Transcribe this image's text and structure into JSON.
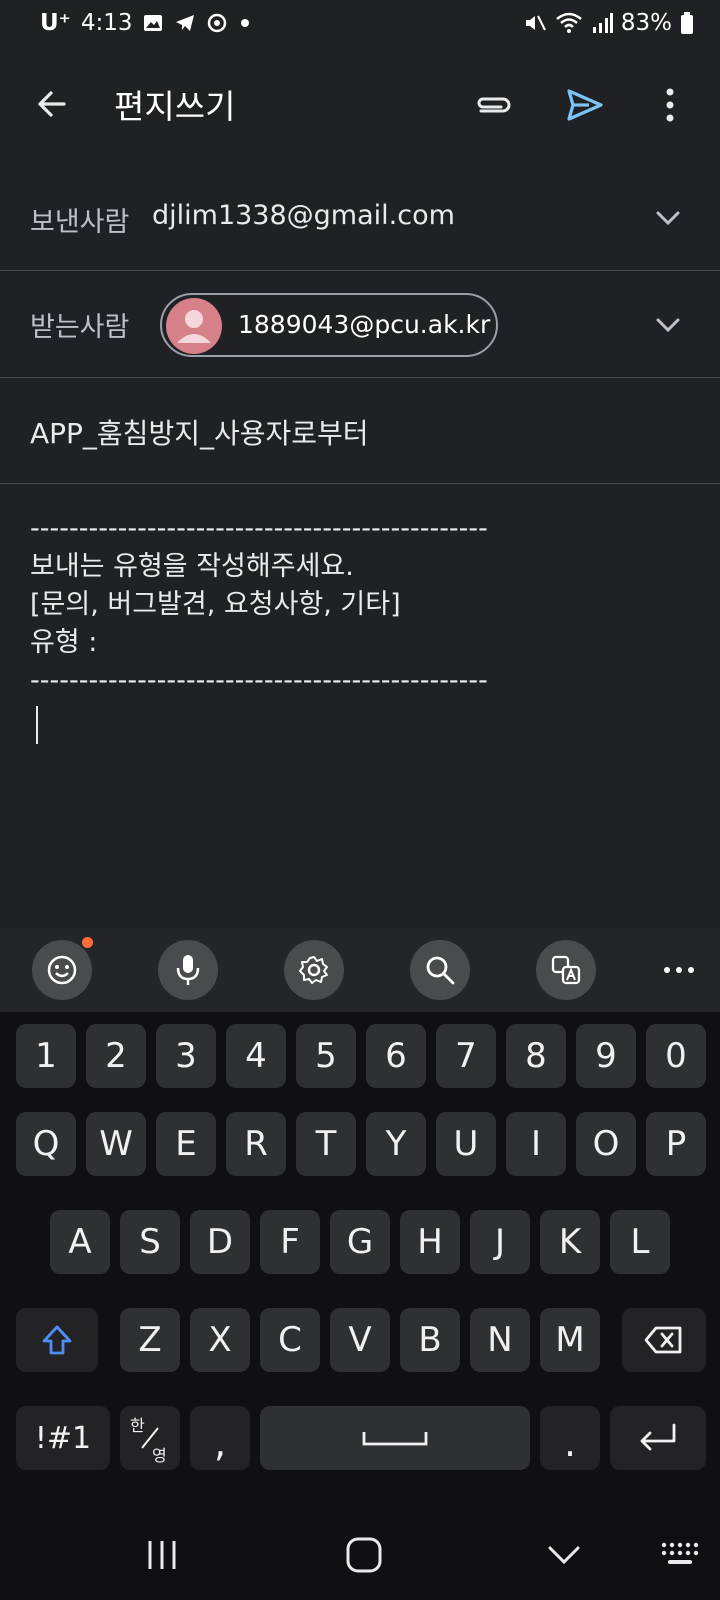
{
  "status_bar": {
    "carrier": "U⁺",
    "time": "4:13",
    "battery": "83%",
    "icons": [
      "gallery-icon",
      "telegram-icon",
      "sync-icon",
      "dot-icon",
      "mute-icon",
      "wifi-icon",
      "signal-icon",
      "battery-icon"
    ]
  },
  "app_bar": {
    "title": "편지쓰기",
    "icons": [
      "back-arrow-icon",
      "paperclip-icon",
      "send-icon",
      "more-vert-icon"
    ],
    "send_color": "#7cc4f8"
  },
  "compose": {
    "from_label": "보낸사람",
    "from_value": "djlim1338@gmail.com",
    "to_label": "받는사람",
    "to_chip": "1889043@pcu.ak.kr",
    "subject": "APP_훔침방지_사용자로부터",
    "body_lines": [
      "-----------------------------------------------",
      "보내는 유형을 작성해주세요.",
      "[문의, 버그발견, 요청사항, 기타]",
      "유형 :",
      "-----------------------------------------------"
    ],
    "avatar_color": "#d6808a"
  },
  "keyboard": {
    "toolbar_icons": [
      "emoji-icon",
      "mic-icon",
      "settings-icon",
      "search-icon",
      "translate-icon",
      "more-horiz-icon"
    ],
    "row_numbers": [
      "1",
      "2",
      "3",
      "4",
      "5",
      "6",
      "7",
      "8",
      "9",
      "0"
    ],
    "row_top": [
      "Q",
      "W",
      "E",
      "R",
      "T",
      "Y",
      "U",
      "I",
      "O",
      "P"
    ],
    "row_home": [
      "A",
      "S",
      "D",
      "F",
      "G",
      "H",
      "J",
      "K",
      "L"
    ],
    "row_bottom": [
      "Z",
      "X",
      "C",
      "V",
      "B",
      "N",
      "M"
    ],
    "symbols_key": "!#1",
    "lang_key_top": "한",
    "lang_key_bottom": "영",
    "comma_key": ",",
    "period_key": ".",
    "accent_color": "#4e8ff7"
  },
  "nav_bar": {
    "icons": [
      "recents-icon",
      "home-icon",
      "back-down-icon",
      "keyboard-icon"
    ]
  }
}
